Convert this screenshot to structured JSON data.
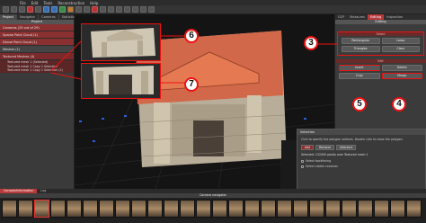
{
  "menu": [
    "File",
    "Edit",
    "Tools",
    "Reconstruction",
    "Help"
  ],
  "left_tabs": [
    {
      "label": "Project",
      "active": true
    },
    {
      "label": "Navigator"
    },
    {
      "label": "Cameras"
    },
    {
      "label": "Statistics"
    }
  ],
  "project_header": "Project",
  "tree": [
    {
      "label": "Cameras (29 out of 29)",
      "state": "red"
    },
    {
      "label": "Sparse Point Cloud (1)",
      "state": "red"
    },
    {
      "label": "Dense Point Cloud (1)",
      "state": "red"
    },
    {
      "label": "Meshes (1)",
      "state": "dark"
    },
    {
      "label": "Textured Meshes (4)",
      "state": "sel"
    }
  ],
  "tree_subitems": [
    "Textured mesh 1 (Selected)",
    "Textured mesh 1 Copy 1 Selection",
    "Textured mesh 1 Copy 1 Selection (2)"
  ],
  "right_tabs": [
    {
      "label": "GCP"
    },
    {
      "label": "Measures"
    },
    {
      "label": "Editing",
      "active": true
    },
    {
      "label": "Inspection"
    }
  ],
  "right_header": "Editing",
  "right_section_1": "Select",
  "right_buttons_1": [
    "Rectangular",
    "Lasso",
    "Triangles",
    "Clear"
  ],
  "right_section_2": "Edit",
  "right_buttons_2": [
    "Invert",
    "Delete",
    "Crop",
    "Merge"
  ],
  "dialog": {
    "title": "Selection",
    "description": "Click to specify the polygon vertices. Double click to close the polygon.",
    "mode_buttons": [
      "Add",
      "Remove",
      "Intersect"
    ],
    "status": "Selected: 132000 points over Textured mesh 1",
    "check_1": "Select backfacing",
    "check_2": "Select visible cameras"
  },
  "console_tabs": [
    {
      "label": "Console/Information",
      "active": true
    },
    {
      "label": "Log"
    }
  ],
  "camera_navigator_title": "Camera navigator",
  "badges": [
    "3",
    "4",
    "5",
    "6",
    "7"
  ],
  "colors": {
    "accent": "#e11111",
    "panel": "#3a3a3a",
    "selection": "#8a3030"
  }
}
